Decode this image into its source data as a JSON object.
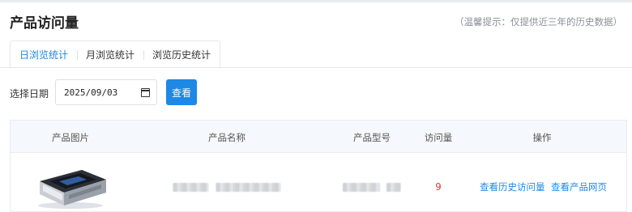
{
  "header": {
    "title": "产品访问量",
    "hint": "（温馨提示：仅提供近三年的历史数据）"
  },
  "tabs": [
    {
      "label": "日浏览统计",
      "active": true
    },
    {
      "label": "月浏览统计",
      "active": false
    },
    {
      "label": "浏览历史统计",
      "active": false
    }
  ],
  "filter": {
    "date_label": "选择日期",
    "date_value": "2025/09/03",
    "query_label": "查看"
  },
  "table": {
    "columns": [
      "产品图片",
      "产品名称",
      "产品型号",
      "访问量",
      "操作"
    ],
    "rows": [
      {
        "visits": "9",
        "actions": [
          "查看历史访问量",
          "查看产品网页"
        ]
      }
    ]
  },
  "colors": {
    "accent": "#1e88e5",
    "visits": "#e53935",
    "header_bg": "#f5f8fc"
  }
}
